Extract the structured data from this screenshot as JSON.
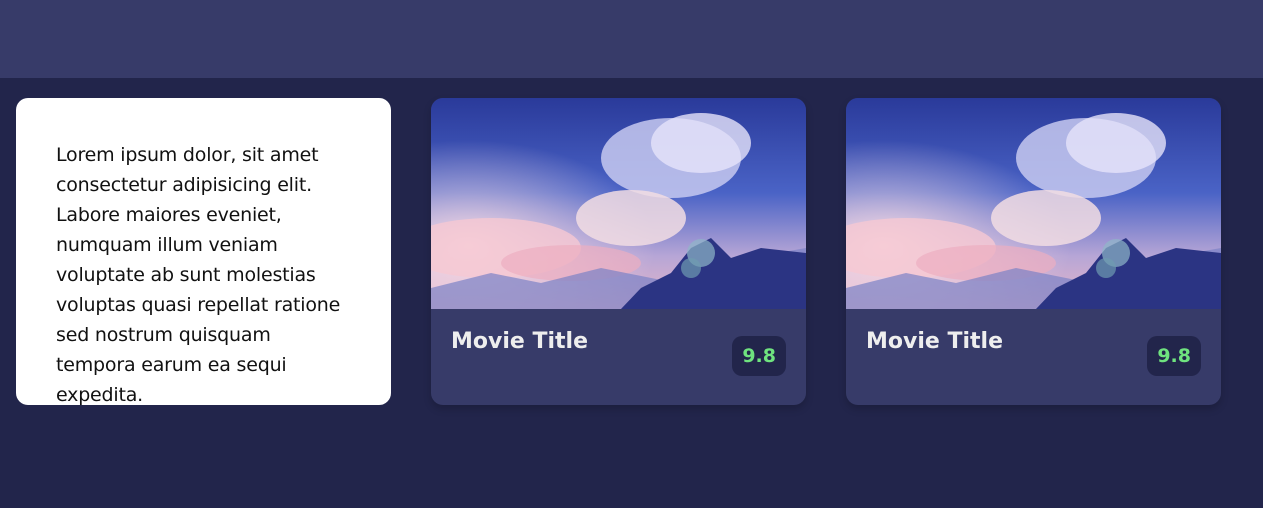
{
  "overview": {
    "text": "Lorem ipsum dolor, sit amet consectetur adipisicing elit. Labore maiores eveniet, numquam illum veniam voluptate ab sunt molestias voluptas quasi repellat ratione sed nostrum quisquam tempora earum ea sequi expedita."
  },
  "movies": [
    {
      "title": "Movie Title",
      "rating": "9.8"
    },
    {
      "title": "Movie Title",
      "rating": "9.8"
    }
  ],
  "colors": {
    "background": "#22254b",
    "header": "#373b69",
    "card": "#373b69",
    "rating_text": "#6fe37f"
  }
}
